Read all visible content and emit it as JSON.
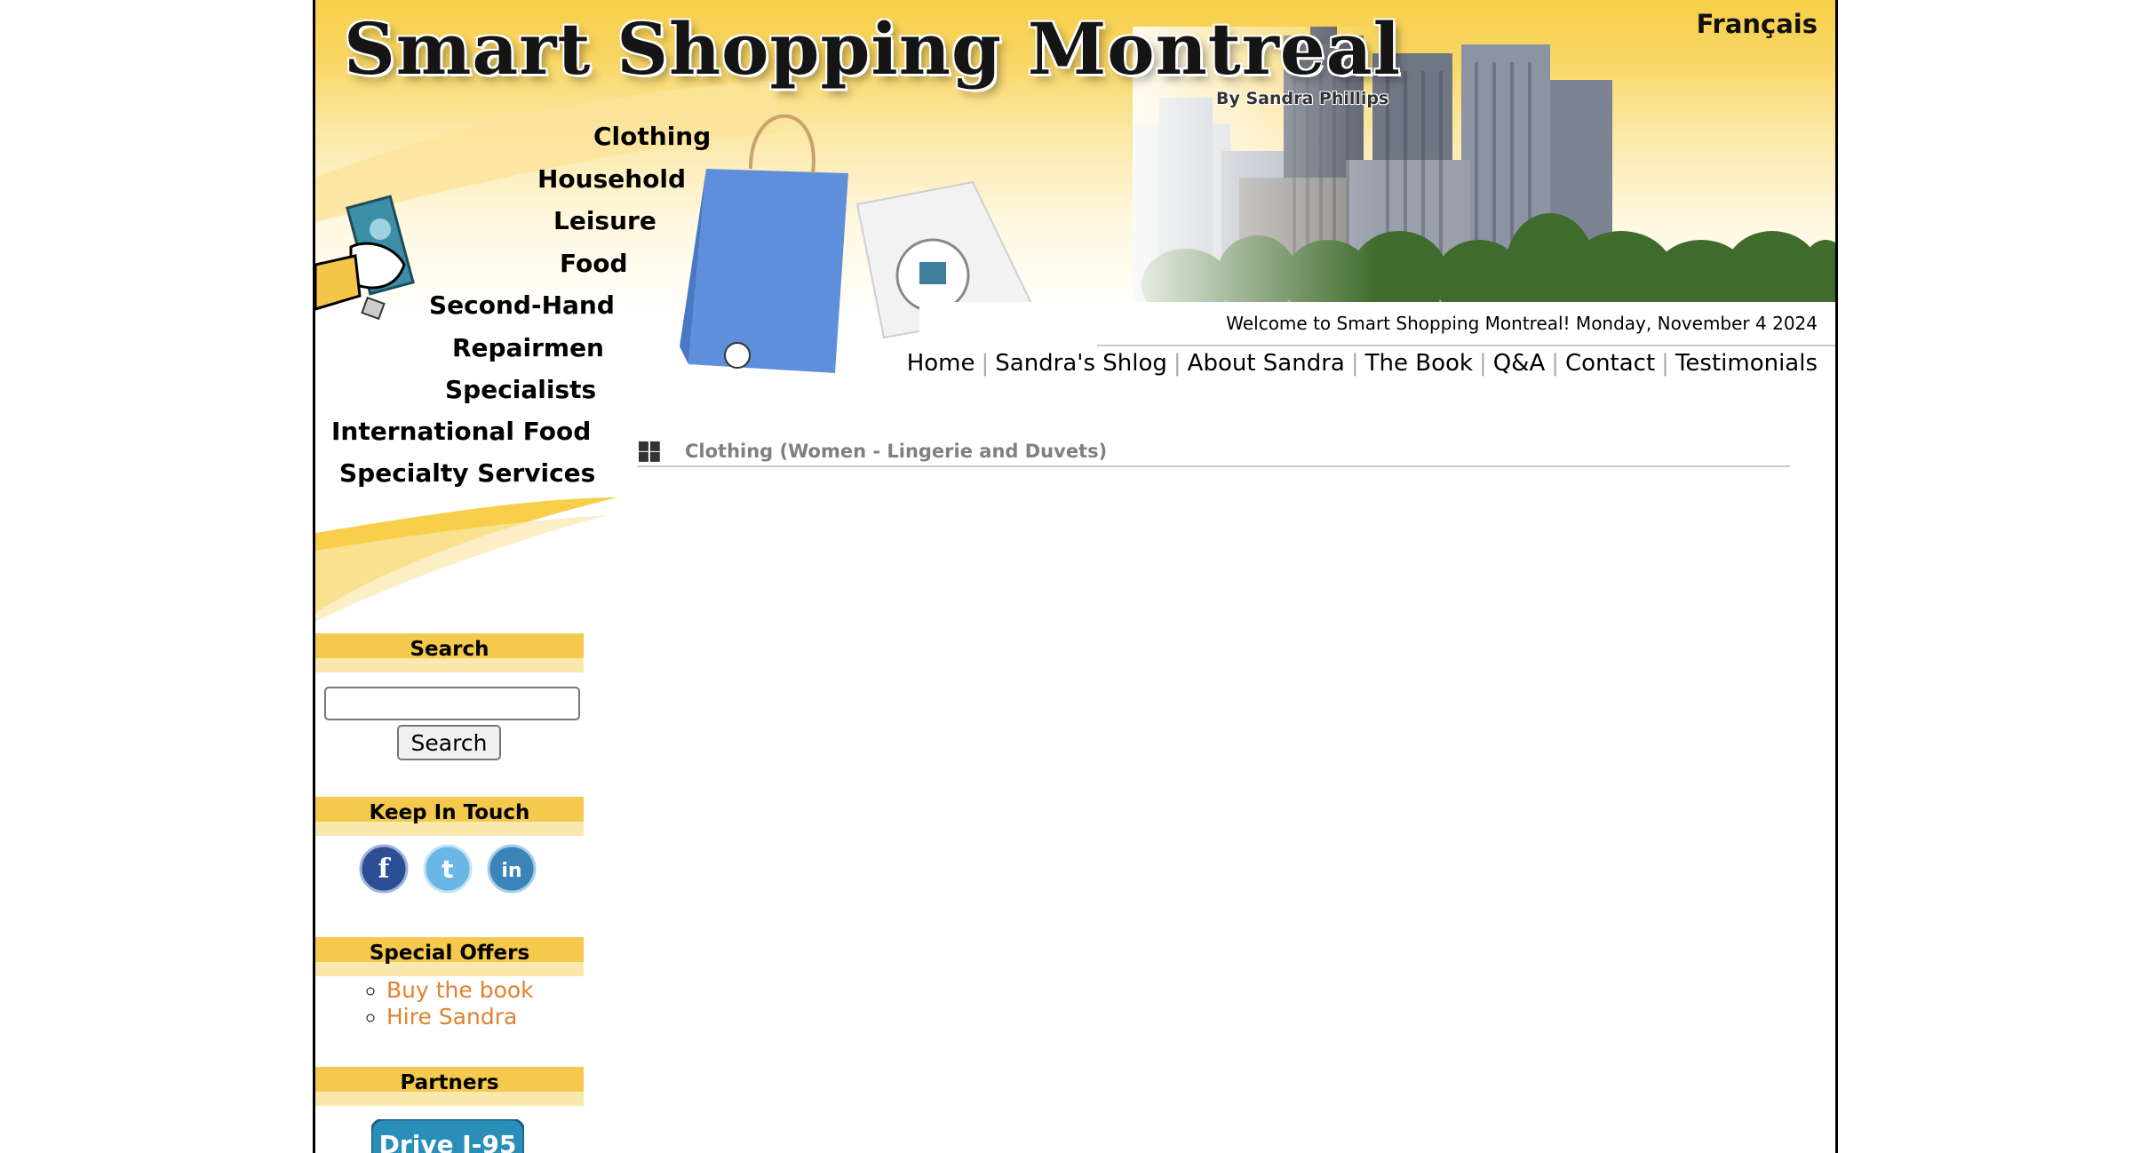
{
  "site": {
    "title": "Smart Shopping Montreal",
    "byline": "By Sandra Phillips",
    "language_link": "Français"
  },
  "categories": [
    {
      "label": "Clothing"
    },
    {
      "label": "Household"
    },
    {
      "label": "Leisure"
    },
    {
      "label": "Food"
    },
    {
      "label": "Second-Hand"
    },
    {
      "label": "Repairmen"
    },
    {
      "label": "Specialists"
    },
    {
      "label": "International Food"
    },
    {
      "label": "Specialty Services"
    }
  ],
  "welcome": "Welcome to Smart Shopping Montreal! Monday, November 4 2024",
  "topnav": [
    {
      "label": "Home"
    },
    {
      "label": "Sandra's Shlog"
    },
    {
      "label": "About Sandra"
    },
    {
      "label": "The Book"
    },
    {
      "label": "Q&A"
    },
    {
      "label": "Contact"
    },
    {
      "label": "Testimonials"
    }
  ],
  "breadcrumb": "Clothing (Women - Lingerie and Duvets)",
  "sidebar": {
    "search": {
      "heading": "Search",
      "value": "",
      "button": "Search"
    },
    "keep_in_touch": {
      "heading": "Keep In Touch",
      "icons": [
        "facebook-icon",
        "twitter-icon",
        "linkedin-icon"
      ]
    },
    "special_offers": {
      "heading": "Special Offers",
      "items": [
        "Buy the book",
        "Hire Sandra"
      ]
    },
    "partners": {
      "heading": "Partners",
      "logo_text": "Drive I-95"
    }
  },
  "colors": {
    "header_yellow": "#f7cf4a",
    "sidebar_heading": "#f5c94d",
    "offer_link": "#e0822e",
    "breadcrumb_text": "#808080"
  }
}
